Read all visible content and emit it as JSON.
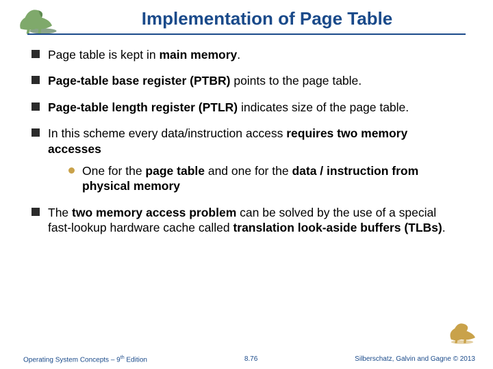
{
  "title": "Implementation of Page Table",
  "bullets": {
    "b1_pre": "Page table is kept in ",
    "b1_bold": "main memory",
    "b1_post": ".",
    "b2_bold": "Page-table base register (PTBR)",
    "b2_post": " points to the page table.",
    "b3_bold": "Page-table length register (PTLR)",
    "b3_post": " indicates size of the page table.",
    "b4_pre": "In this scheme every data/instruction access ",
    "b4_bold": "requires two memory accesses",
    "b4_sub_pre": "One for the ",
    "b4_sub_b1": "page table",
    "b4_sub_mid": " and one for the ",
    "b4_sub_b2": "data / instruction from physical memory",
    "b5_pre": "The ",
    "b5_b1": "two memory access problem",
    "b5_mid": " can be solved by the use of a special fast-lookup hardware cache called ",
    "b5_b2": "translation look-aside buffers (TLBs)",
    "b5_post": "."
  },
  "footer": {
    "left_a": "Operating System Concepts – 9",
    "left_b": " Edition",
    "center": "8.76",
    "right": "Silberschatz, Galvin and Gagne © 2013"
  }
}
